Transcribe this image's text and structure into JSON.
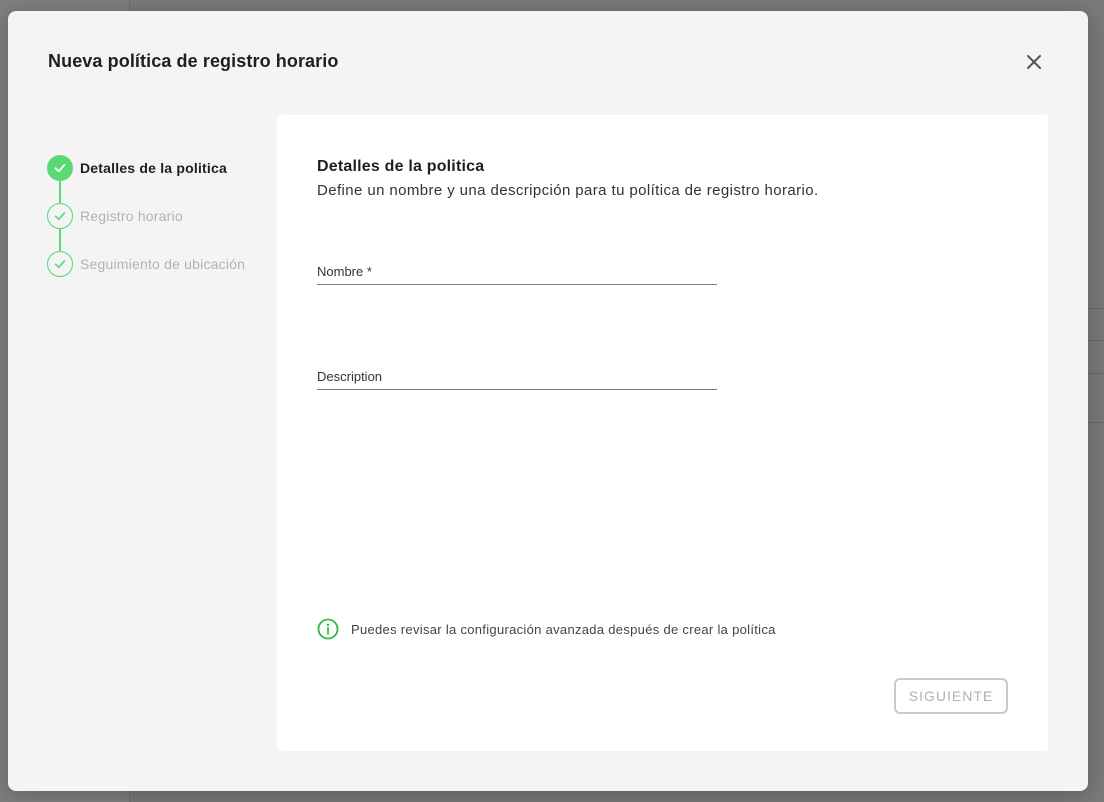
{
  "modal": {
    "title": "Nueva política de registro horario"
  },
  "stepper": {
    "steps": [
      {
        "label": "Detalles de la politica",
        "state": "active"
      },
      {
        "label": "Registro horario",
        "state": "pending"
      },
      {
        "label": "Seguimiento de ubicación",
        "state": "pending"
      }
    ]
  },
  "form": {
    "section_title": "Detalles de la politica",
    "section_description": "Define un nombre y una descripción para tu política de registro horario.",
    "name_placeholder": "Nombre *",
    "description_placeholder": "Description",
    "info_text": "Puedes revisar la configuración avanzada después de crear la política",
    "next_label": "SIGUIENTE"
  },
  "icons": {
    "close": "close-icon",
    "check": "check-icon",
    "info": "info-icon"
  },
  "colors": {
    "accent_green": "#5ad873",
    "info_green": "#2fb94a",
    "disabled_gray": "#b0b0b0"
  }
}
